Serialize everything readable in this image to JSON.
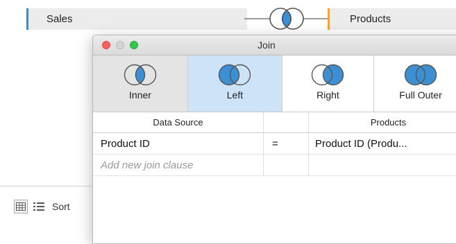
{
  "canvas": {
    "left_source": "Sales",
    "right_source": "Products",
    "colors": {
      "sales_accent": "#4b86b4",
      "products_accent": "#f4a23c",
      "venn_blue": "#3d8fd4"
    }
  },
  "bottom_bar": {
    "sort_label": "Sort"
  },
  "dialog": {
    "title": "Join",
    "join_types": [
      {
        "label": "Inner",
        "icon": "venn-inner-icon"
      },
      {
        "label": "Left",
        "icon": "venn-left-icon",
        "selected": true
      },
      {
        "label": "Right",
        "icon": "venn-right-icon"
      },
      {
        "label": "Full Outer",
        "icon": "venn-full-outer-icon"
      }
    ],
    "table": {
      "headers": [
        "Data Source",
        "",
        "Products"
      ],
      "rows": [
        {
          "left": "Product ID",
          "op": "=",
          "right": "Product ID (Produ..."
        }
      ],
      "placeholder": "Add new join clause"
    }
  }
}
